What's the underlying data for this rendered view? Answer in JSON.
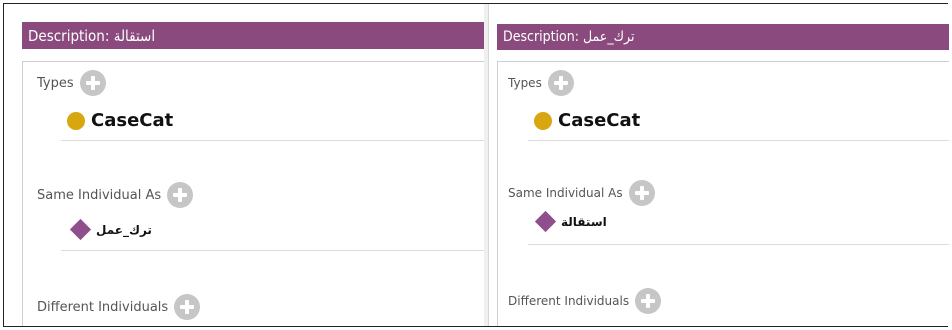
{
  "left_panel": {
    "header": "Description: استقالة",
    "types_label": "Types",
    "type_class": "CaseCat",
    "same_label": "Same Individual As",
    "same_individual": "ترك_عمل",
    "different_label": "Different Individuals"
  },
  "right_panel": {
    "header": "Description: ترك_عمل",
    "types_label": "Types",
    "type_class": "CaseCat",
    "same_label": "Same Individual As",
    "same_individual": "استقالة",
    "different_label": "Different Individuals"
  },
  "colors": {
    "header_bg": "#8a4a7e",
    "class_dot": "#d8a60e",
    "individual_diamond": "#8e4f8c",
    "add_button": "#c6c6c6"
  },
  "icons": [
    "add-icon",
    "class-icon",
    "individual-icon"
  ]
}
